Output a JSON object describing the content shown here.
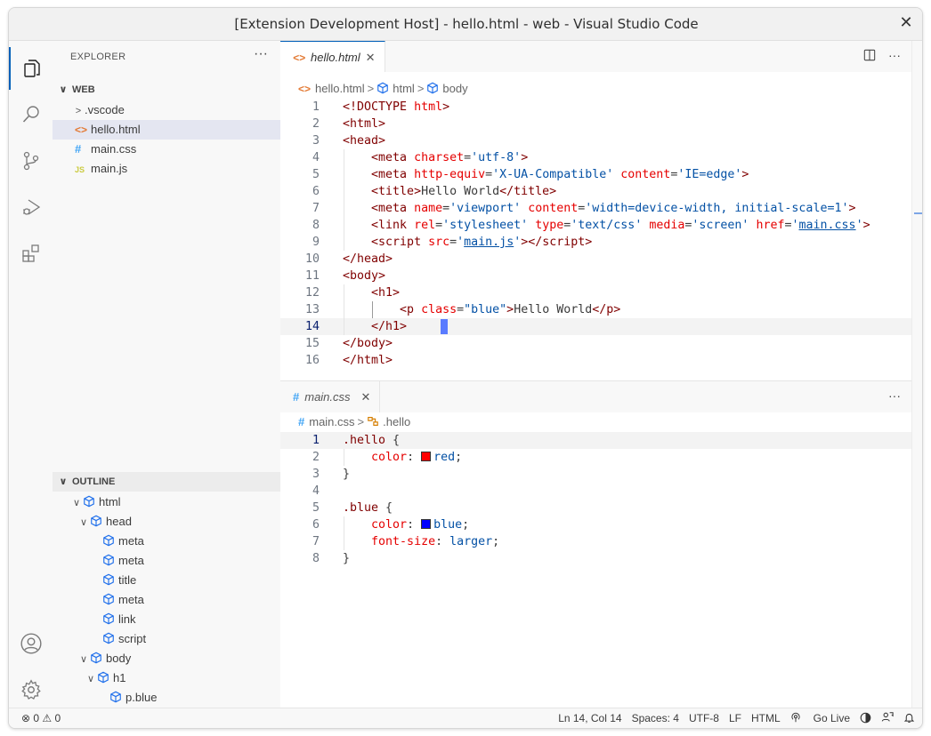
{
  "window": {
    "title": "[Extension Development Host] - hello.html - web - Visual Studio Code",
    "close_glyph": "✕"
  },
  "activity_bar": {
    "icons": [
      "explorer-icon",
      "search-icon",
      "source-control-icon",
      "run-debug-icon",
      "extensions-icon",
      "account-icon",
      "gear-icon"
    ]
  },
  "sidebar": {
    "title": "EXPLORER",
    "more": "···",
    "workspace": "WEB",
    "files": [
      {
        "label": ".vscode",
        "type": "folder"
      },
      {
        "label": "hello.html",
        "type": "html",
        "icon_text": "<>"
      },
      {
        "label": "main.css",
        "type": "css",
        "icon_text": "#"
      },
      {
        "label": "main.js",
        "type": "js",
        "icon_text": "JS"
      }
    ],
    "outline_title": "OUTLINE",
    "outline": [
      {
        "label": "html"
      },
      {
        "label": "head"
      },
      {
        "label": "meta"
      },
      {
        "label": "meta"
      },
      {
        "label": "title"
      },
      {
        "label": "meta"
      },
      {
        "label": "link"
      },
      {
        "label": "script"
      },
      {
        "label": "body"
      },
      {
        "label": "h1"
      },
      {
        "label": "p.blue"
      }
    ]
  },
  "editor_top": {
    "tab_icon": "<>",
    "tab_label": "hello.html",
    "tab_close": "✕",
    "actions_more": "···",
    "breadcrumb": {
      "file_icon": "<>",
      "file": "hello.html",
      "crumb1": "html",
      "crumb2": "body"
    },
    "line_numbers": [
      "1",
      "2",
      "3",
      "4",
      "5",
      "6",
      "7",
      "8",
      "9",
      "10",
      "11",
      "12",
      "13",
      "14",
      "15",
      "16"
    ],
    "current_line": 14
  },
  "editor_bottom": {
    "tab_icon": "#",
    "tab_label": "main.css",
    "tab_close": "✕",
    "actions_more": "···",
    "breadcrumb": {
      "file_icon": "#",
      "file": "main.css",
      "crumb1": ".hello"
    },
    "line_numbers": [
      "1",
      "2",
      "3",
      "4",
      "5",
      "6",
      "7",
      "8"
    ],
    "current_line": 1,
    "swatch_red": "#ff0000",
    "swatch_blue": "#0000ff"
  },
  "statusbar": {
    "problems": "⊗ 0 ⚠ 0",
    "position": "Ln 14, Col 14",
    "spaces": "Spaces: 4",
    "encoding": "UTF-8",
    "eol": "LF",
    "language": "HTML",
    "go_live": "Go Live"
  },
  "colors": {
    "accent": "#005fb8",
    "cursor": "#5a7bff",
    "tag": "#800000",
    "attribute": "#e50000",
    "string": "#0451a5"
  }
}
